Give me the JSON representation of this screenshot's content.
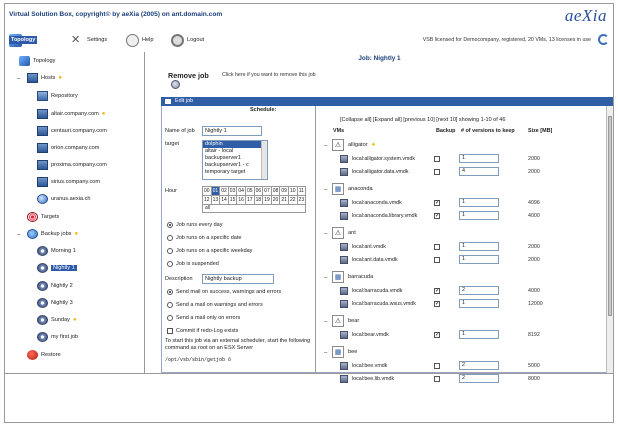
{
  "app": {
    "title": "Virtual Solution Box, copyright© by aeXia (2005) on ant.domain.com",
    "logo": "aeXia",
    "license": "VSB licensed for Democompany, registered, 20 VMs, 13 licenses in use"
  },
  "toolbar": {
    "topology": "Topology",
    "settings": "Settings",
    "help": "Help",
    "logout": "Logout"
  },
  "sidebar": {
    "topology": "Topology",
    "hosts": "Hosts",
    "repository": "Repository",
    "hosts_list": [
      "altair.company.com",
      "centauri.company.com",
      "orion.company.com",
      "proxima.company.com",
      "sirius.company.com",
      "uranus.aexia.ch"
    ],
    "targets": "Targets",
    "backup_jobs": "Backup jobs",
    "jobs": [
      "Morning 1",
      "Nightly 1",
      "Nightly 2",
      "Nightly 3",
      "Sunday",
      "my first job"
    ],
    "restore": "Restore"
  },
  "main": {
    "job_title": "Job: Nightly 1",
    "remove_job": "Remove job",
    "remove_hint": "Click here if you want to remove this job",
    "edit_job": "Edit job",
    "schedule": "Schedule:",
    "name_label": "Name of job",
    "name_value": "Nightly 1",
    "target_label": "target",
    "target_options": [
      "dolphin",
      "altair - local",
      "backupserver1",
      "backupserver1 - c",
      "temporary target"
    ],
    "target_selected": "dolphin",
    "hour_label": "Hour",
    "hours": [
      "00",
      "01",
      "02",
      "03",
      "04",
      "05",
      "06",
      "07",
      "08",
      "09",
      "10",
      "11",
      "12",
      "13",
      "14",
      "15",
      "16",
      "17",
      "18",
      "19",
      "20",
      "21",
      "22",
      "23"
    ],
    "hour_selected": "01",
    "hour_all": "all",
    "schedule_options": [
      "Job runs every day",
      "Job runs on a specific date",
      "Job runs on a specific weekday",
      "Job is suspended"
    ],
    "schedule_selected": 0,
    "description_label": "Description",
    "description_value": "Nightly backup",
    "mail_options": [
      "Send mail on success, warnings and errors",
      "Send a mail on warnings and errors",
      "Send a mail only on errors"
    ],
    "mail_selected": 0,
    "commit_label": "Commit if redo-Log exists",
    "external_note": "To start this job via an external scheduler, start the following command as root on an ESX Server",
    "command": "/opt/vsb/sbin/getjob 6"
  },
  "vms": {
    "pager": "[Collapse all] [Expand all] [previous 10] [next 10] showing 1-10 of 46",
    "col_vms": "VMs",
    "col_backup": "Backup",
    "col_versions": "# of versions to keep",
    "col_size": "Size [MB]",
    "items": [
      {
        "name": "alligator",
        "star": true,
        "disks": [
          {
            "file": "local:alligator.system.vmdk",
            "backup": false,
            "versions": "1",
            "size": "2000"
          },
          {
            "file": "local:alligator.data.vmdk",
            "backup": false,
            "versions": "4",
            "size": "2000"
          }
        ]
      },
      {
        "name": "anaconda",
        "star": false,
        "disks": [
          {
            "file": "local:anaconda.vmdk",
            "backup": true,
            "versions": "1",
            "size": "4096"
          },
          {
            "file": "local:anaconda.library.vmdk",
            "backup": true,
            "versions": "1",
            "size": "4000"
          }
        ]
      },
      {
        "name": "ant",
        "star": false,
        "disks": [
          {
            "file": "local:ant.vmdk",
            "backup": false,
            "versions": "1",
            "size": "2000"
          },
          {
            "file": "local:ant.data.vmdk",
            "backup": false,
            "versions": "1",
            "size": "2000"
          }
        ]
      },
      {
        "name": "barracuda",
        "star": false,
        "disks": [
          {
            "file": "local:barracuda.vmdk",
            "backup": true,
            "versions": "2",
            "size": "4000"
          },
          {
            "file": "local:barracuda.wsus.vmdk",
            "backup": true,
            "versions": "1",
            "size": "12000"
          }
        ]
      },
      {
        "name": "bear",
        "star": false,
        "disks": [
          {
            "file": "local:bear.vmdk",
            "backup": true,
            "versions": "1",
            "size": "8192"
          }
        ]
      },
      {
        "name": "bee",
        "star": false,
        "disks": [
          {
            "file": "local:bee.vmdk",
            "backup": false,
            "versions": "2",
            "size": "5000"
          },
          {
            "file": "local:bee.lib.vmdk",
            "backup": false,
            "versions": "2",
            "size": "8000"
          }
        ]
      }
    ]
  },
  "colors": {
    "accent": "#2f5ea6",
    "title": "#1a3f7a",
    "star": "#f0b400"
  }
}
